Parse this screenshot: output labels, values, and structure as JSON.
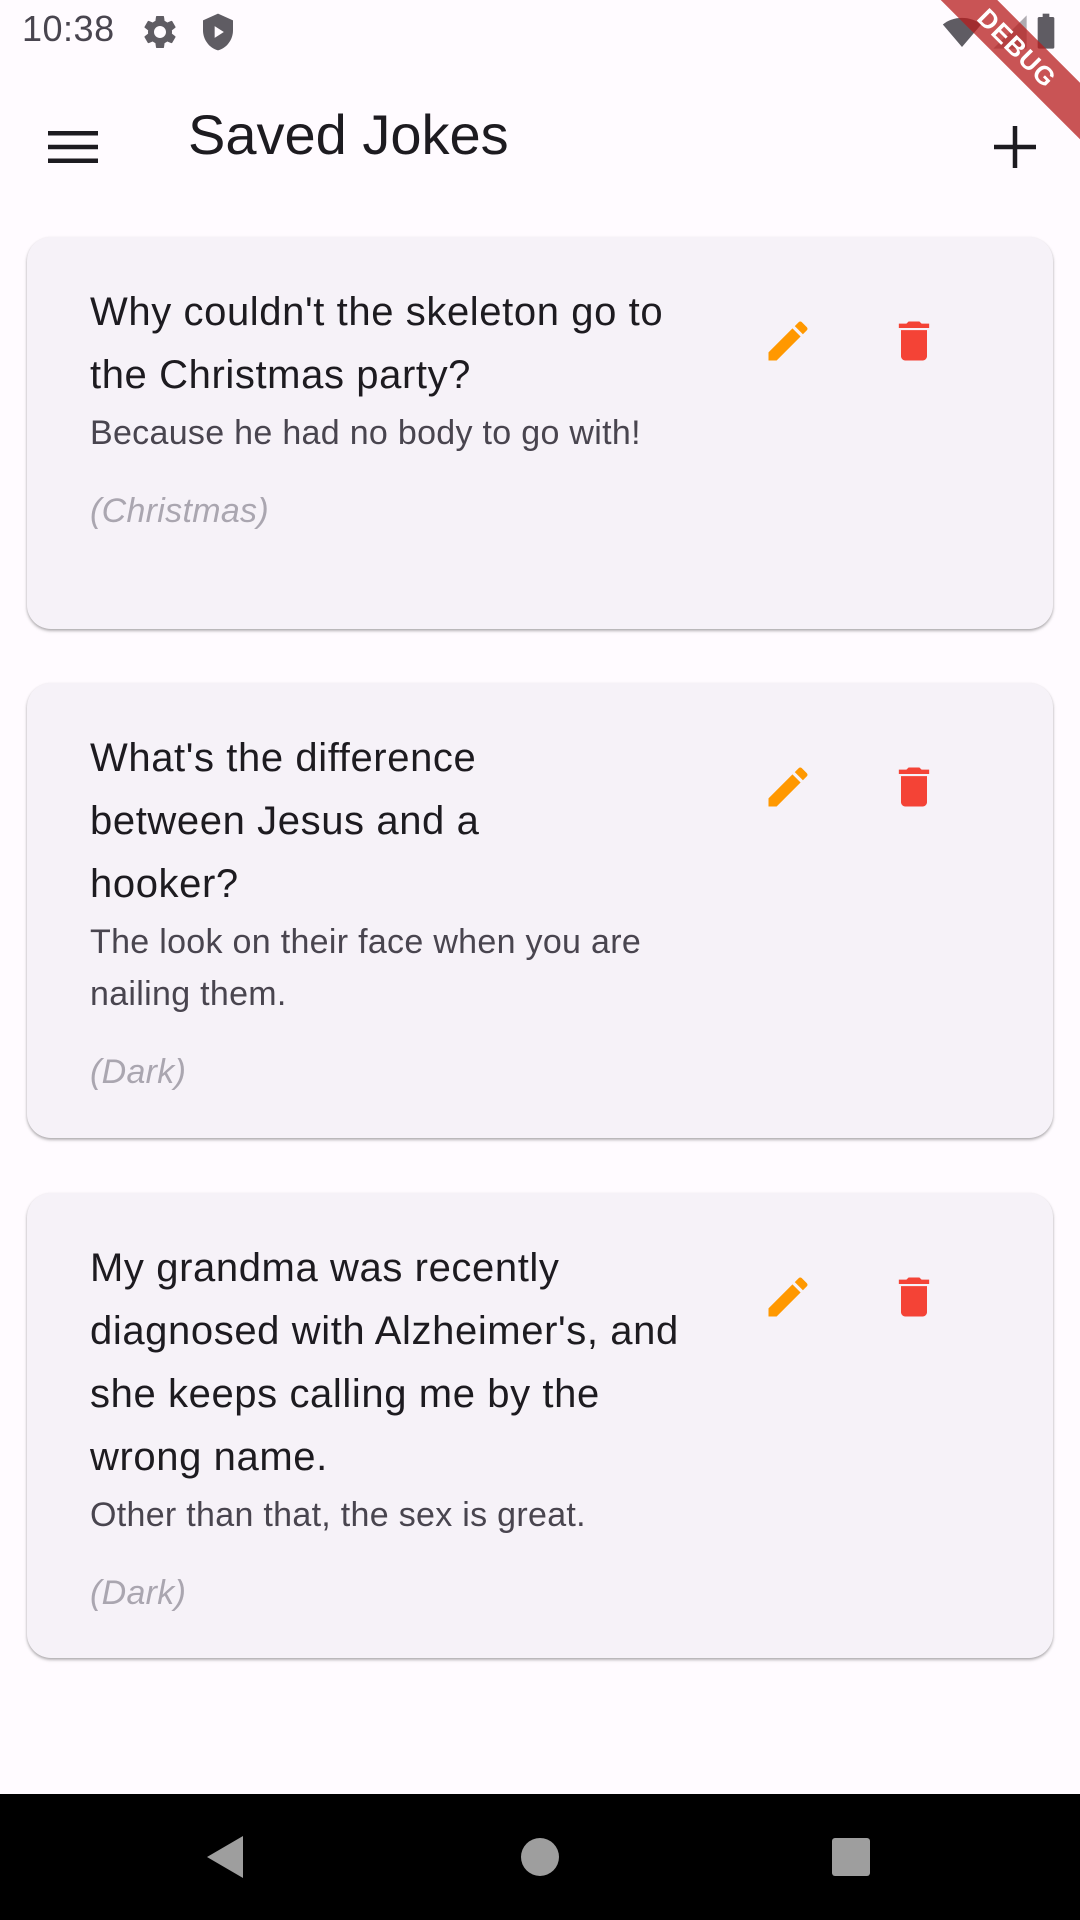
{
  "status_bar": {
    "time": "10:38",
    "icons": [
      "settings-icon",
      "shield-play-icon",
      "wifi-icon",
      "signal-icon",
      "battery-icon"
    ]
  },
  "debug_banner": {
    "label": "DEBUG"
  },
  "app_bar": {
    "title": "Saved Jokes",
    "menu_icon": "menu-icon",
    "add_icon": "add-icon"
  },
  "jokes": [
    {
      "setup": "Why couldn't the skeleton go to the Christmas party?",
      "punchline": "Because he had no body to go with!",
      "category": "(Christmas)"
    },
    {
      "setup": "What's the difference between Jesus and a hooker?",
      "punchline": "The look on their face when you are nailing them.",
      "category": "(Dark)"
    },
    {
      "setup": "My grandma was recently diagnosed with Alzheimer's, and she keeps calling me by the wrong name.",
      "punchline": "Other than that, the sex is great.",
      "category": "(Dark)"
    }
  ],
  "colors": {
    "edit_icon": "#ff9800",
    "delete_icon": "#f44336",
    "card_background": "#f6f2f8",
    "debug_banner": "#b71c1c"
  },
  "nav_bar": {
    "icons": [
      "back-icon",
      "home-icon",
      "recents-icon"
    ]
  }
}
